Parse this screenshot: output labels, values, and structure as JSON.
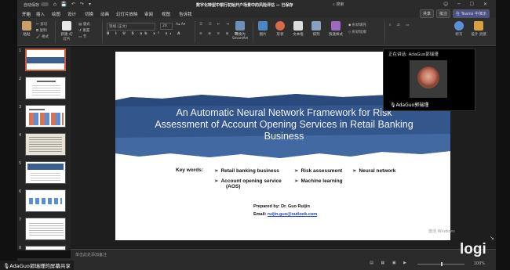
{
  "titlebar": {
    "autosave": "自动保存",
    "doc_title": "数字化转型中银行初始开户场景中的风险评估 — 已保存",
    "search": "搜索"
  },
  "tabs": [
    "开始",
    "插入",
    "绘图",
    "设计",
    "切换",
    "动画",
    "幻灯片放映",
    "审阅",
    "视图",
    "告诉我"
  ],
  "tab_right": {
    "share": "共享",
    "comment": "批注",
    "teams": "在 Teams 中演示"
  },
  "ribbon": {
    "paste": "粘贴",
    "cut": "剪切",
    "copy": "复制",
    "format": "格式",
    "new_slide": "新建\n幻灯片",
    "layout": "版式",
    "reset": "重置",
    "section": "节",
    "font_name": "等线 (正文)",
    "font_size": "20",
    "convert_smartart": "转换为\nSmartArt",
    "picture": "图片",
    "shapes": "形状",
    "textbox": "文本框",
    "arrange": "排列",
    "quick_styles": "快速样式",
    "shape_fill": "形状填充",
    "shape_outline": "形状轮廓",
    "dictate": "听写",
    "designer": "设计\n灵感"
  },
  "slides": {
    "numbers": [
      "1",
      "2",
      "3",
      "4",
      "5",
      "6",
      "7",
      "8"
    ]
  },
  "slide": {
    "title": "An Automatic Neural Network Framework for Risk Assessment of Account Opening Services in Retail Banking Business",
    "keywords_label": "Key words:",
    "keywords": {
      "k1": "Retail banking business",
      "k2": "Risk assessment",
      "k3": "Neural network",
      "k4": "Account opening service",
      "k4_sub": "(AOS)",
      "k5": "Machine learning"
    },
    "prepared_by": "Prepared by: Dr. Guo Ruijin",
    "email_label": "Email: ",
    "email": "ruijin.guo@outlook.com"
  },
  "video": {
    "presenting": "正在讲话: AdaGuo郭瑞瑾",
    "name": "AdaGuo郭瑞瑾"
  },
  "notes": {
    "placeholder": "单击此处添加备注"
  },
  "status": {
    "zoom": "100%"
  },
  "share_bar": {
    "label": "AdaGuo郭瑞瑾的屏幕共享"
  },
  "logo": {
    "text": "logi"
  },
  "watermark": {
    "text": "激活 Windows"
  }
}
